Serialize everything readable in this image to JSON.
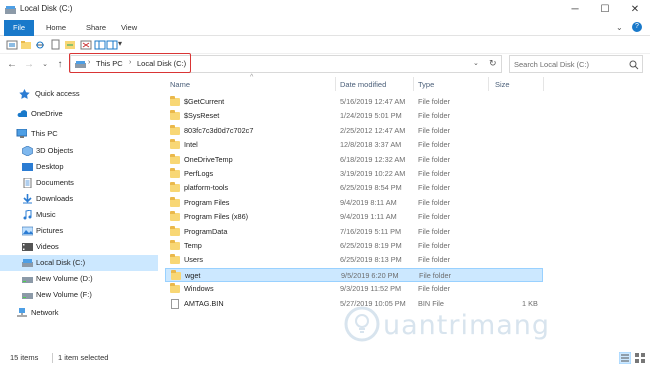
{
  "window": {
    "title": "Local Disk (C:)",
    "controls": [
      "minimize",
      "maximize",
      "close"
    ]
  },
  "ribbon": {
    "tabs": [
      {
        "label": "File"
      },
      {
        "label": "Home"
      },
      {
        "label": "Share"
      },
      {
        "label": "View"
      }
    ]
  },
  "address": {
    "crumbs": [
      "This PC",
      "Local Disk (C:)"
    ]
  },
  "search": {
    "placeholder": "Search Local Disk (C:)"
  },
  "sidebar": {
    "items": [
      {
        "label": "Quick access",
        "icon": "star-icon"
      },
      {
        "label": "OneDrive",
        "icon": "cloud-icon"
      },
      {
        "label": "This PC",
        "icon": "computer-icon"
      },
      {
        "label": "3D Objects",
        "icon": "cube-icon"
      },
      {
        "label": "Desktop",
        "icon": "desktop-icon"
      },
      {
        "label": "Documents",
        "icon": "document-icon"
      },
      {
        "label": "Downloads",
        "icon": "download-icon"
      },
      {
        "label": "Music",
        "icon": "music-icon"
      },
      {
        "label": "Pictures",
        "icon": "picture-icon"
      },
      {
        "label": "Videos",
        "icon": "video-icon"
      },
      {
        "label": "Local Disk (C:)",
        "icon": "drive-icon"
      },
      {
        "label": "New Volume (D:)",
        "icon": "drive-icon"
      },
      {
        "label": "New Volume (F:)",
        "icon": "drive-icon"
      },
      {
        "label": "Network",
        "icon": "network-icon"
      }
    ]
  },
  "columns": {
    "name": "Name",
    "date": "Date modified",
    "type": "Type",
    "size": "Size"
  },
  "files": [
    {
      "name": "$GetCurrent",
      "date": "5/16/2019 12:47 AM",
      "type": "File folder",
      "size": ""
    },
    {
      "name": "$SysReset",
      "date": "1/24/2019 5:01 PM",
      "type": "File folder",
      "size": ""
    },
    {
      "name": "803fc7c3d0d7c702c7",
      "date": "2/25/2012 12:47 AM",
      "type": "File folder",
      "size": ""
    },
    {
      "name": "Intel",
      "date": "12/8/2018 3:37 AM",
      "type": "File folder",
      "size": ""
    },
    {
      "name": "OneDriveTemp",
      "date": "6/18/2019 12:32 AM",
      "type": "File folder",
      "size": ""
    },
    {
      "name": "PerfLogs",
      "date": "3/19/2019 10:22 AM",
      "type": "File folder",
      "size": ""
    },
    {
      "name": "platform-tools",
      "date": "6/25/2019 8:54 PM",
      "type": "File folder",
      "size": ""
    },
    {
      "name": "Program Files",
      "date": "9/4/2019 8:11 AM",
      "type": "File folder",
      "size": ""
    },
    {
      "name": "Program Files (x86)",
      "date": "9/4/2019 1:11 AM",
      "type": "File folder",
      "size": ""
    },
    {
      "name": "ProgramData",
      "date": "7/16/2019 5:11 PM",
      "type": "File folder",
      "size": ""
    },
    {
      "name": "Temp",
      "date": "6/25/2019 8:19 PM",
      "type": "File folder",
      "size": ""
    },
    {
      "name": "Users",
      "date": "6/25/2019 8:13 PM",
      "type": "File folder",
      "size": ""
    },
    {
      "name": "wget",
      "date": "9/5/2019 6:20 PM",
      "type": "File folder",
      "size": ""
    },
    {
      "name": "Windows",
      "date": "9/3/2019 11:52 PM",
      "type": "File folder",
      "size": ""
    },
    {
      "name": "AMTAG.BIN",
      "date": "5/27/2019 10:05 PM",
      "type": "BIN File",
      "size": "1 KB"
    }
  ],
  "status": {
    "count": "15 items",
    "selected": "1 item selected"
  },
  "watermark": {
    "text": "uantrimang"
  },
  "colors": {
    "accent": "#1979ca",
    "selection": "#cce8ff",
    "folder": "#f8d775",
    "highlight": "#d93535"
  }
}
